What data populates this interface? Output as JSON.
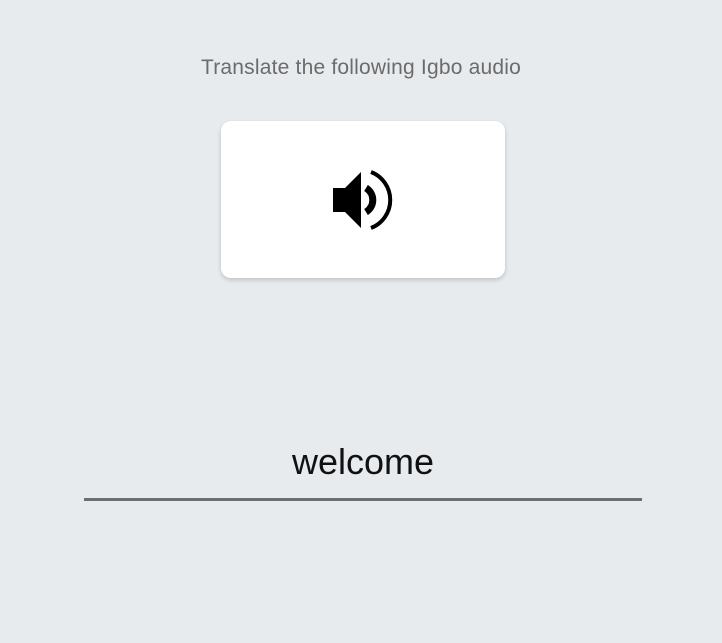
{
  "prompt": {
    "text": "Translate the following Igbo audio"
  },
  "audio_card": {
    "icon": "speaker-volume-icon"
  },
  "answer": {
    "value": "welcome",
    "placeholder": ""
  },
  "colors": {
    "background": "#e8ebee",
    "card": "#ffffff",
    "prompt_text": "#6b6b6b",
    "underline": "#6e6e6e"
  }
}
